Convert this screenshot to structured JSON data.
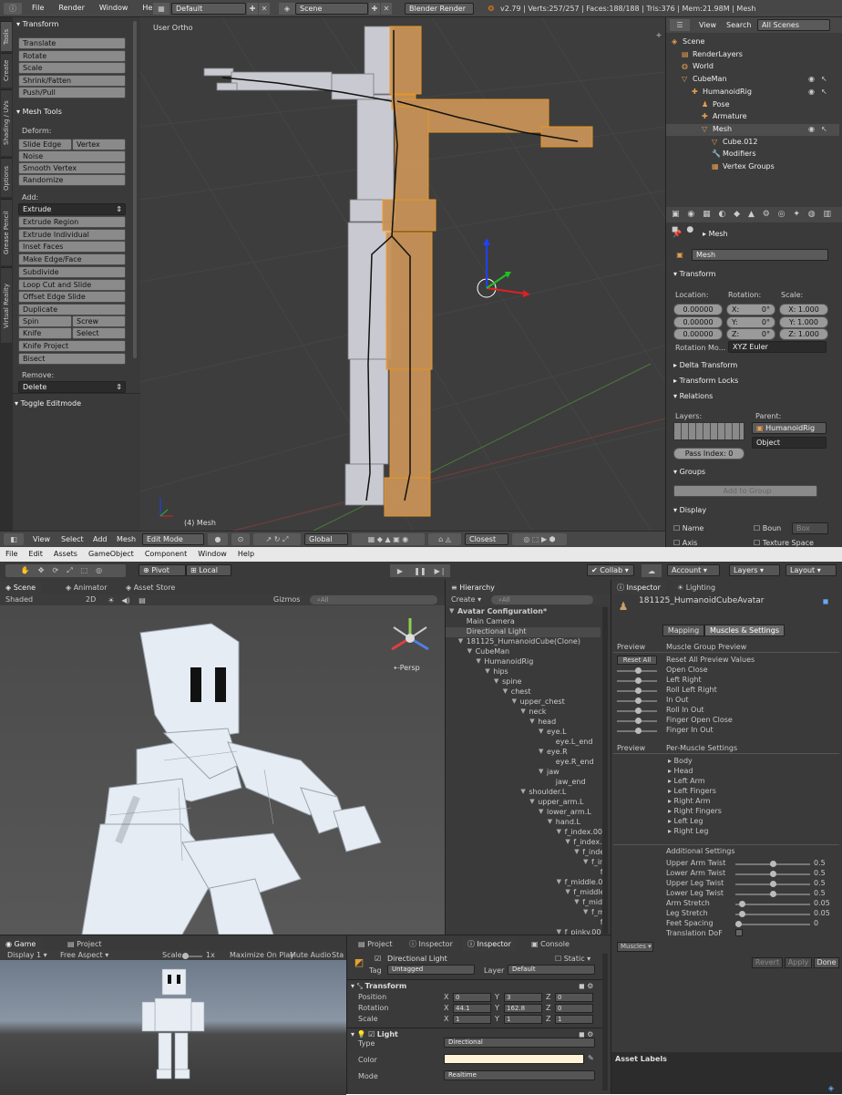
{
  "blender": {
    "menu": [
      "File",
      "Render",
      "Window",
      "Help"
    ],
    "layout": "Default",
    "scene": "Scene",
    "engine": "Blender Render",
    "stats": "v2.79 | Verts:257/257 | Faces:188/188 | Tris:376 | Mem:21.98M | Mesh",
    "vtabs": [
      "Tools",
      "Create",
      "Shading / UVs",
      "Options",
      "Grease Pencil",
      "Virtual Reality"
    ],
    "tools": {
      "transform_title": "Transform",
      "transform": [
        "Translate",
        "Rotate",
        "Scale",
        "Shrink/Fatten",
        "Push/Pull"
      ],
      "meshtools_title": "Mesh Tools",
      "deform_label": "Deform:",
      "slide_edge": "Slide Edge",
      "vertex": "Vertex",
      "noise": "Noise",
      "smooth_vertex": "Smooth Vertex",
      "randomize": "Randomize",
      "add_label": "Add:",
      "extrude": "Extrude",
      "add": [
        "Extrude Region",
        "Extrude Individual",
        "Inset Faces",
        "Make Edge/Face",
        "Subdivide",
        "Loop Cut and Slide",
        "Offset Edge Slide",
        "Duplicate"
      ],
      "spin": "Spin",
      "screw": "Screw",
      "knife": "Knife",
      "select": "Select",
      "knife_project": "Knife Project",
      "bisect": "Bisect",
      "remove_label": "Remove:",
      "delete": "Delete",
      "toggle": "Toggle Editmode"
    },
    "viewport": {
      "label": "User Ortho",
      "obj": "(4) Mesh"
    },
    "footer": {
      "view": "View",
      "select": "Select",
      "add": "Add",
      "mesh": "Mesh",
      "mode": "Edit Mode",
      "orient": "Global",
      "snap": "Closest"
    },
    "outliner": {
      "view": "View",
      "search": "Search",
      "filter": "All Scenes",
      "items": [
        "Scene",
        "RenderLayers",
        "World",
        "CubeMan",
        "HumanoidRig",
        "Pose",
        "Armature",
        "Mesh",
        "Cube.012",
        "Modifiers",
        "Vertex Groups"
      ]
    },
    "props": {
      "crumb": "Mesh",
      "name": "Mesh",
      "transform": "Transform",
      "loc_label": "Location:",
      "rot_label": "Rotation:",
      "scale_label": "Scale:",
      "loc": [
        "0.00000",
        "0.00000",
        "0.00000"
      ],
      "rot": [
        "X:",
        "0°",
        "Y:",
        "0°",
        "Z:",
        "0°"
      ],
      "scale": [
        "X: 1.000",
        "Y: 1.000",
        "Z: 1.000"
      ],
      "rotmode_label": "Rotation Mo...",
      "rotmode": "XYZ Euler",
      "delta": "Delta Transform",
      "locks": "Transform Locks",
      "relations": "Relations",
      "layers": "Layers:",
      "parent": "Parent:",
      "parent_val": "HumanoidRig",
      "parent_type": "Object",
      "pass_index": "Pass Index:",
      "pass_val": "0",
      "groups": "Groups",
      "add_group": "Add to Group",
      "display": "Display",
      "name_cb": "Name",
      "bounds_cb": "Boun",
      "bounds_val": "Box",
      "axis_cb": "Axis",
      "texspace_cb": "Texture Space"
    }
  },
  "unity": {
    "menu": [
      "File",
      "Edit",
      "Assets",
      "GameObject",
      "Component",
      "Window",
      "Help"
    ],
    "toolbar": {
      "pivot": "Pivot",
      "local": "Local",
      "collab": "Collab",
      "account": "Account",
      "layers": "Layers",
      "layout": "Layout"
    },
    "scene_tabs": [
      "Scene",
      "Animator",
      "Asset Store"
    ],
    "scene_bar": {
      "shaded": "Shaded",
      "mode2d": "2D",
      "gizmos": "Gizmos",
      "search": "All"
    },
    "persp": "Persp",
    "hierarchy": {
      "tab": "Hierarchy",
      "create": "Create",
      "search": "All",
      "rows": [
        {
          "t": "Avatar Configuration*",
          "d": 0,
          "bold": true,
          "tri": true
        },
        {
          "t": "Main Camera",
          "d": 1
        },
        {
          "t": "Directional Light",
          "d": 1,
          "sel": true
        },
        {
          "t": "181125_HumanoidCube(Clone)",
          "d": 1,
          "tri": true
        },
        {
          "t": "CubeMan",
          "d": 2,
          "tri": true
        },
        {
          "t": "HumanoidRig",
          "d": 3,
          "tri": true
        },
        {
          "t": "hips",
          "d": 4,
          "tri": true
        },
        {
          "t": "spine",
          "d": 5,
          "tri": true
        },
        {
          "t": "chest",
          "d": 6,
          "tri": true
        },
        {
          "t": "upper_chest",
          "d": 7,
          "tri": true
        },
        {
          "t": "neck",
          "d": 8,
          "tri": true
        },
        {
          "t": "head",
          "d": 9,
          "tri": true
        },
        {
          "t": "eye.L",
          "d": 10,
          "tri": true
        },
        {
          "t": "eye.L_end",
          "d": 11
        },
        {
          "t": "eye.R",
          "d": 10,
          "tri": true
        },
        {
          "t": "eye.R_end",
          "d": 11
        },
        {
          "t": "jaw",
          "d": 10,
          "tri": true
        },
        {
          "t": "jaw_end",
          "d": 11
        },
        {
          "t": "shoulder.L",
          "d": 8,
          "tri": true
        },
        {
          "t": "upper_arm.L",
          "d": 9,
          "tri": true
        },
        {
          "t": "lower_arm.L",
          "d": 10,
          "tri": true
        },
        {
          "t": "hand.L",
          "d": 11,
          "tri": true
        },
        {
          "t": "f_index.00",
          "d": 12,
          "tri": true
        },
        {
          "t": "f_index.(",
          "d": 13,
          "tri": true
        },
        {
          "t": "f_inde",
          "d": 14,
          "tri": true
        },
        {
          "t": "f_in",
          "d": 15,
          "tri": true
        },
        {
          "t": "f",
          "d": 16
        },
        {
          "t": "f_middle.0(",
          "d": 12,
          "tri": true
        },
        {
          "t": "f_middle",
          "d": 13,
          "tri": true
        },
        {
          "t": "f_mid",
          "d": 14,
          "tri": true
        },
        {
          "t": "f_m",
          "d": 15,
          "tri": true
        },
        {
          "t": "f",
          "d": 16
        },
        {
          "t": "f_pinky.00",
          "d": 12,
          "tri": true
        }
      ]
    },
    "inspector": {
      "tab1": "Inspector",
      "tab2": "Lighting",
      "title": "181125_HumanoidCubeAvatar",
      "mapping": "Mapping",
      "muscles": "Muscles & Settings",
      "preview": "Preview",
      "mgp": "Muscle Group Preview",
      "reset_all": "Reset All",
      "preview_rows": [
        "Reset All Preview Values",
        "Open Close",
        "Left Right",
        "Roll Left Right",
        "In Out",
        "Roll In Out",
        "Finger Open Close",
        "Finger In Out"
      ],
      "preview2": "Preview",
      "pms": "Per-Muscle Settings",
      "muscle_groups": [
        "Body",
        "Head",
        "Left Arm",
        "Left Fingers",
        "Right Arm",
        "Right Fingers",
        "Left Leg",
        "Right Leg"
      ],
      "additional": "Additional Settings",
      "settings": [
        {
          "k": "Upper Arm Twist",
          "v": "0.5",
          "f": 0.5
        },
        {
          "k": "Lower Arm Twist",
          "v": "0.5",
          "f": 0.5
        },
        {
          "k": "Upper Leg Twist",
          "v": "0.5",
          "f": 0.5
        },
        {
          "k": "Lower Leg Twist",
          "v": "0.5",
          "f": 0.5
        },
        {
          "k": "Arm Stretch",
          "v": "0.05",
          "f": 0.05
        },
        {
          "k": "Leg Stretch",
          "v": "0.05",
          "f": 0.05
        },
        {
          "k": "Feet Spacing",
          "v": "0",
          "f": 0.0
        }
      ],
      "translation_dof": "Translation DoF",
      "muscles_dd": "Muscles",
      "revert": "Revert",
      "apply": "Apply",
      "done": "Done",
      "asset_labels": "Asset Labels"
    },
    "game": {
      "tab": "Game",
      "project": "Project",
      "display": "Display 1",
      "aspect": "Free Aspect",
      "scale_lbl": "Scale",
      "scale_val": "1x",
      "max": "Maximize On Play",
      "mute": "Mute Audio",
      "stats": "Sta"
    },
    "insp2": {
      "tabs": [
        "Project",
        "Inspector",
        "Inspector",
        "Console"
      ],
      "name": "Directional Light",
      "static": "Static",
      "tag_lbl": "Tag",
      "tag": "Untagged",
      "layer_lbl": "Layer",
      "layer": "Default",
      "transform": "Transform",
      "position": "Position",
      "rotation": "Rotation",
      "scale": "Scale",
      "pos": [
        "0",
        "3",
        "0"
      ],
      "rot": [
        "44.1",
        "162.8",
        "0"
      ],
      "scl": [
        "1",
        "1",
        "1"
      ],
      "light": "Light",
      "type_lbl": "Type",
      "type": "Directional",
      "color_lbl": "Color",
      "mode_lbl": "Mode",
      "mode": "Realtime",
      "light_color": "#fff2d6"
    }
  }
}
